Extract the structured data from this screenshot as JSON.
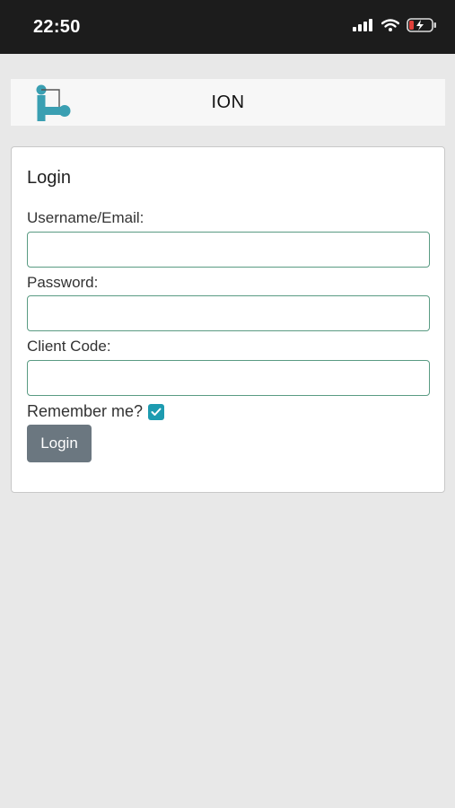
{
  "status_bar": {
    "time": "22:50",
    "icons": [
      "signal-icon",
      "wifi-icon",
      "battery-charging-icon"
    ]
  },
  "header": {
    "title": "ION",
    "logo_icon": "ion-logo-icon",
    "brand_color": "#3a9fb2"
  },
  "login": {
    "title": "Login",
    "username_label": "Username/Email:",
    "username_value": "",
    "password_label": "Password:",
    "password_value": "",
    "client_code_label": "Client Code:",
    "client_code_value": "",
    "remember_label": "Remember me?",
    "remember_checked": true,
    "button_label": "Login"
  },
  "colors": {
    "input_border": "#5a9b83",
    "checkbox": "#1d9bb0",
    "button": "#6b7780",
    "background": "#e8e8e8"
  }
}
